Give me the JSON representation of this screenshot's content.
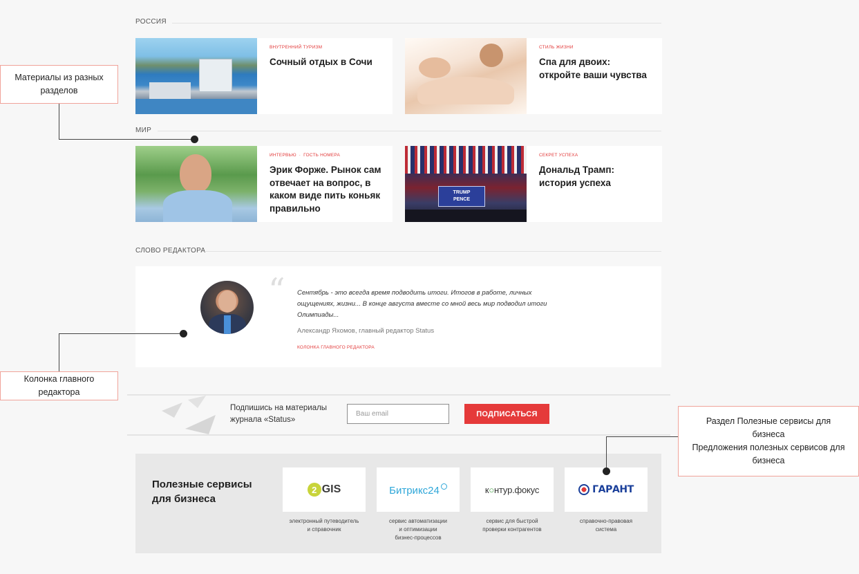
{
  "sections": {
    "russia": "РОССИЯ",
    "world": "МИР",
    "editor": "СЛОВО РЕДАКТОРА"
  },
  "articles": [
    {
      "tags": [
        "ВНУТРЕННИЙ ТУРИЗМ"
      ],
      "title": "Сочный отдых в Сочи"
    },
    {
      "tags": [
        "СТИЛЬ ЖИЗНИ"
      ],
      "title": "Спа для двоих: откройте ваши чувства"
    },
    {
      "tags": [
        "ИНТЕРВЬЮ",
        "ГОСТЬ НОМЕРА"
      ],
      "title": "Эрик Форже. Рынок сам отвечает на вопрос, в каком виде пить коньяк правильно"
    },
    {
      "tags": [
        "СЕКРЕТ УСПЕХА"
      ],
      "title": "Дональд Трамп: история успеха",
      "image_text": [
        "TRUMP",
        "PENCE"
      ]
    }
  ],
  "editor_column": {
    "quote": "Сентябрь - это всегда время подводить итоги. Итогов в работе, личных ощущениях, жизни... В конце августа вместе со мной весь мир подводил итоги Олимпиады...",
    "author": "Александр Яхомов, главный редактор Status",
    "link": "КОЛОНКА ГЛАВНОГО РЕДАКТОРА"
  },
  "subscribe": {
    "text_line1": "Подпишись на материалы",
    "text_line2": "журнала «Status»",
    "email_placeholder": "Ваш email",
    "button": "ПОДПИСАТЬСЯ"
  },
  "services": {
    "title_line1": "Полезные сервисы",
    "title_line2": "для бизнеса",
    "items": [
      {
        "logo": "2GIS",
        "desc_line1": "электронный путеводитель",
        "desc_line2": "и справочник",
        "desc_line3": ""
      },
      {
        "logo": "Битрикс24",
        "desc_line1": "сервис автоматизации",
        "desc_line2": "и оптимизации",
        "desc_line3": "бизнес-процессов"
      },
      {
        "logo_part1": "к",
        "logo_part2": "нтур.фокус",
        "desc_line1": "сервис для быстрой",
        "desc_line2": "проверки контрагентов",
        "desc_line3": ""
      },
      {
        "logo": "ГАРАНТ",
        "desc_line1": "справочно-правовая",
        "desc_line2": "система",
        "desc_line3": ""
      }
    ]
  },
  "annotations": {
    "materials_line1": "Материалы из разных",
    "materials_line2": "разделов",
    "editor_line1": "Колонка главного",
    "editor_line2": "редактора",
    "services_line1": "Раздел Полезные сервисы для",
    "services_line2": "бизнеса",
    "services_line3": "Предложения полезных сервисов для",
    "services_line4": "бизнеса"
  },
  "colors": {
    "accent": "#e53a3a",
    "callout_border": "#f0a39a",
    "background": "#f7f7f7"
  },
  "icons": {
    "subscribe": "paper-plane-icon",
    "quote": "quote-mark-icon"
  }
}
